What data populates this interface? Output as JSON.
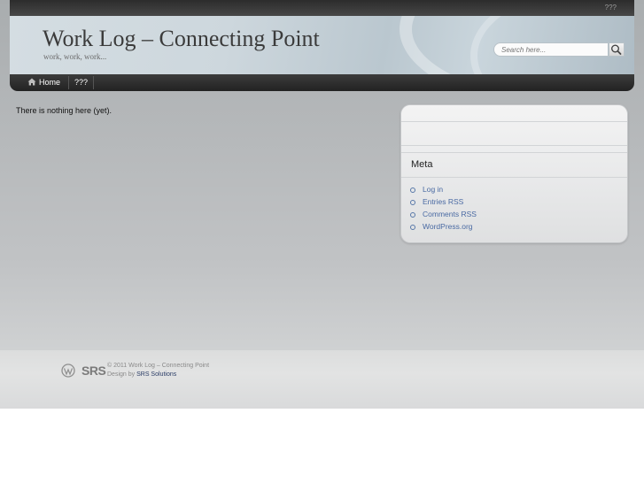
{
  "topbar": {
    "link": "???"
  },
  "header": {
    "title": "Work Log – Connecting Point",
    "tagline": "work, work, work..."
  },
  "search": {
    "placeholder": "Search here...",
    "icon": "magnifier-icon"
  },
  "nav": {
    "home_icon": "home-icon",
    "items": [
      {
        "label": "Home"
      },
      {
        "label": "???"
      }
    ]
  },
  "content": {
    "message": "There is nothing here (yet)."
  },
  "sidebar": {
    "widget_title": "Meta",
    "links": [
      {
        "label": "Log in"
      },
      {
        "label": "Entries RSS"
      },
      {
        "label": "Comments RSS"
      },
      {
        "label": "WordPress.org"
      }
    ]
  },
  "footer": {
    "logos": {
      "wordpress": "wordpress-logo-icon",
      "srs": "SRS"
    },
    "copyright": "© 2011 Work Log – Connecting Point",
    "design_prefix": "Design by",
    "design_link": "SRS Solutions"
  },
  "colors": {
    "accent_link": "#4a6aa3",
    "nav_bg": "#2a2a2a"
  }
}
